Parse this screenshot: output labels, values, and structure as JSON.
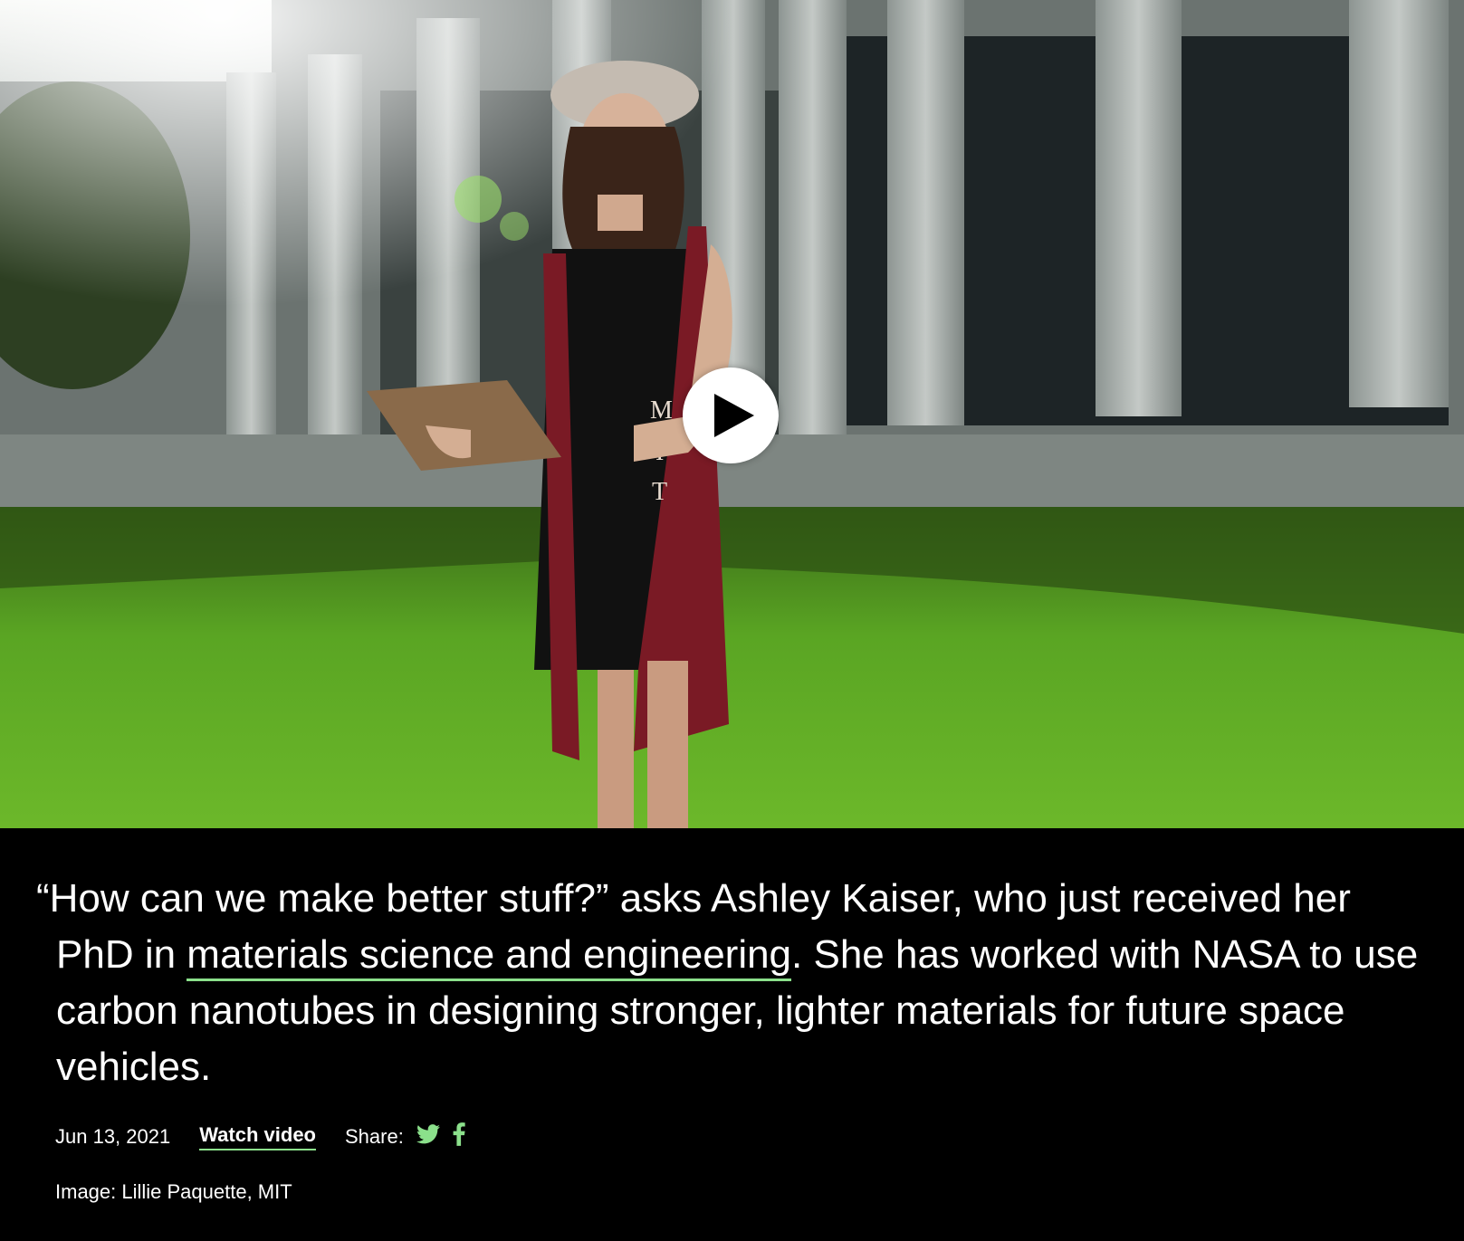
{
  "hero": {
    "image_alt": "Ashley Kaiser in graduation cap and MIT stole standing on lawn in front of columned building",
    "stole_letters": [
      "M",
      "I",
      "T"
    ],
    "play_icon": "play-icon"
  },
  "caption": {
    "before_link": "“How can we make better stuff?” asks Ashley Kaiser, who just received her PhD in ",
    "link_text": "materials science and engineering",
    "after_link": ". She has worked with NASA to use carbon nanotubes in designing stronger, lighter materials for future space vehicles."
  },
  "meta": {
    "date": "Jun 13, 2021",
    "watch_video": "Watch video",
    "share_label": "Share:",
    "share_icons": [
      "twitter-icon",
      "facebook-icon"
    ]
  },
  "credit": "Image: Lillie Paquette, MIT",
  "colors": {
    "accent": "#8be08b",
    "background": "#000000"
  }
}
